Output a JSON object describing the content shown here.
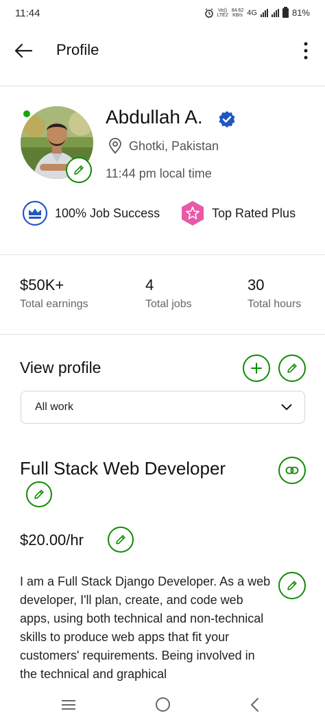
{
  "status_bar": {
    "time": "11:44",
    "network_top": "Vo))",
    "network_bottom": "LTE2",
    "speed_value": "84.62",
    "speed_unit": "KB/s",
    "network_type": "4G",
    "battery": "81%"
  },
  "app_bar": {
    "title": "Profile"
  },
  "profile": {
    "name": "Abdullah A.",
    "location": "Ghotki, Pakistan",
    "local_time": "11:44 pm local time",
    "badges": [
      {
        "label": "100% Job Success",
        "icon": "crown-icon"
      },
      {
        "label": "Top Rated Plus",
        "icon": "star-badge-icon"
      }
    ]
  },
  "stats": [
    {
      "value": "$50K+",
      "label": "Total earnings"
    },
    {
      "value": "4",
      "label": "Total jobs"
    },
    {
      "value": "30",
      "label": "Total hours"
    }
  ],
  "view_profile": {
    "title": "View profile",
    "selected_filter": "All work"
  },
  "job": {
    "title": "Full Stack Web Developer",
    "rate": "$20.00/hr",
    "description": "I am a Full Stack Django Developer. As a web developer, I'll plan, create, and code web apps, using both technical and non-technical skills to produce web apps that fit your customers' requirements. Being involved in the technical and graphical"
  },
  "colors": {
    "accent_green": "#108a00",
    "online_green": "#14a800",
    "verified_blue": "#1f57c3",
    "top_rated_pink": "#e85aa8"
  }
}
